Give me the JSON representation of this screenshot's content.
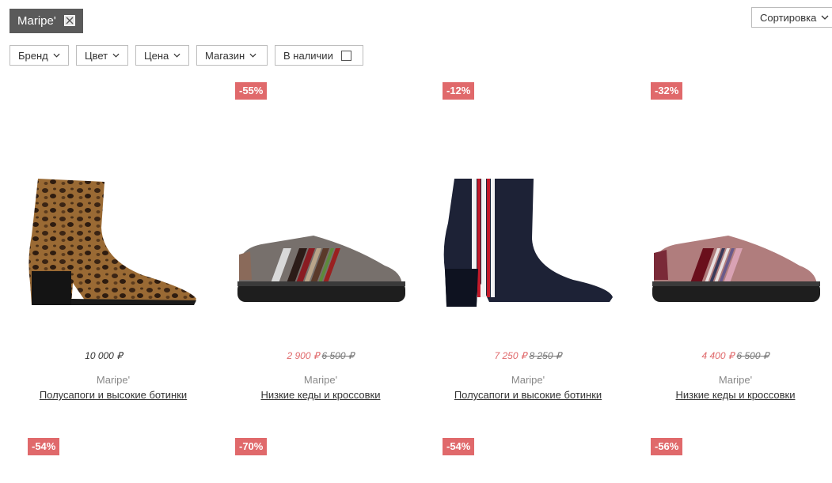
{
  "active_filter": {
    "label": "Maripe'"
  },
  "sort": {
    "label": "Сортировка"
  },
  "filters": [
    {
      "label": "Бренд"
    },
    {
      "label": "Цвет"
    },
    {
      "label": "Цена"
    },
    {
      "label": "Магазин"
    },
    {
      "label": "В наличии"
    }
  ],
  "products": [
    {
      "badge": "",
      "price": "10 000 ₽",
      "old_price": "",
      "brand": "Maripe'",
      "category": "Полусапоги и высокие ботинки"
    },
    {
      "badge": "-55%",
      "price": "2 900 ₽",
      "old_price": "6 500 ₽",
      "brand": "Maripe'",
      "category": "Низкие кеды и кроссовки"
    },
    {
      "badge": "-12%",
      "price": "7 250 ₽",
      "old_price": "8 250 ₽",
      "brand": "Maripe'",
      "category": "Полусапоги и высокие ботинки"
    },
    {
      "badge": "-32%",
      "price": "4 400 ₽",
      "old_price": "6 500 ₽",
      "brand": "Maripe'",
      "category": "Низкие кеды и кроссовки"
    }
  ],
  "second_row_badges": [
    "-54%",
    "-70%",
    "-54%",
    "-56%"
  ],
  "colors": {
    "badge": "#e0696b",
    "chip": "#5a5a5a"
  }
}
